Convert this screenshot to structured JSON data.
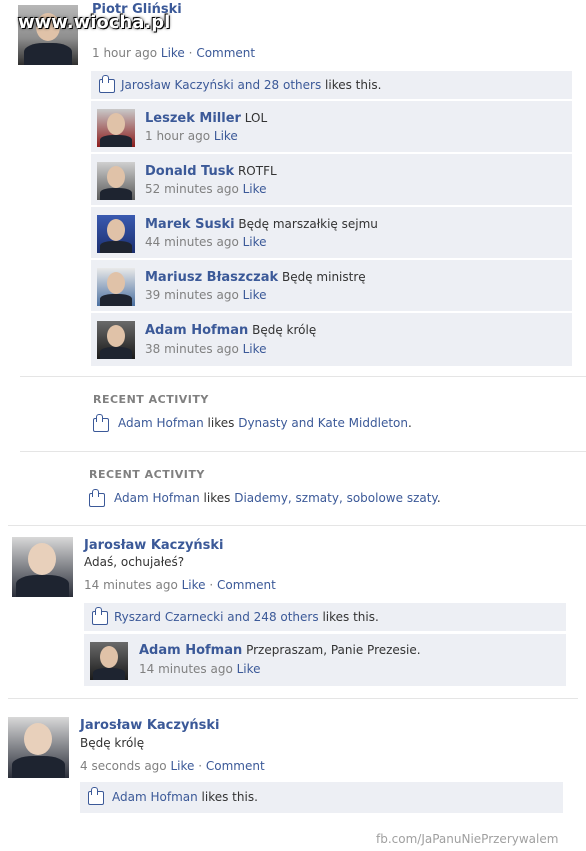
{
  "watermark": "www.wiocha.pl",
  "post1": {
    "author": "Piotr Gliński",
    "meta": {
      "time": "1 hour ago",
      "like": "Like",
      "dot": "·",
      "comment": "Comment"
    },
    "likes": {
      "text": "Jarosław Kaczyński and 28 others",
      "suffix": "likes this."
    },
    "comments": [
      {
        "author": "Leszek Miller",
        "text": "LOL",
        "time": "1 hour ago",
        "like": "Like"
      },
      {
        "author": "Donald Tusk",
        "text": "ROTFL",
        "time": "52 minutes ago",
        "like": "Like"
      },
      {
        "author": "Marek Suski",
        "text": "Będę marszałkię sejmu",
        "time": "44 minutes ago",
        "like": "Like"
      },
      {
        "author": "Mariusz Błaszczak",
        "text": "Będę ministrę",
        "time": "39 minutes ago",
        "like": "Like"
      },
      {
        "author": "Adam Hofman",
        "text": "Będę królę",
        "time": "38 minutes ago",
        "like": "Like"
      }
    ]
  },
  "recent1": {
    "title": "RECENT ACTIVITY",
    "actor": "Adam Hofman",
    "verb": "likes",
    "object": "Dynasty and Kate Middleton",
    "end": "."
  },
  "recent2": {
    "title": "RECENT ACTIVITY",
    "actor": "Adam Hofman",
    "verb": "likes",
    "object": "Diademy, szmaty, sobolowe szaty",
    "end": "."
  },
  "post2": {
    "author": "Jarosław Kaczyński",
    "text": "Adaś, ochujałeś?",
    "meta": {
      "time": "14 minutes ago",
      "like": "Like",
      "dot": "·",
      "comment": "Comment"
    },
    "likes": {
      "text": "Ryszard Czarnecki and 248 others",
      "suffix": "likes this."
    },
    "comment": {
      "author": "Adam Hofman",
      "text": "Przepraszam, Panie Prezesie.",
      "time": "14 minutes ago",
      "like": "Like"
    }
  },
  "post3": {
    "author": "Jarosław Kaczyński",
    "text": "Będę królę",
    "meta": {
      "time": "4 seconds ago",
      "like": "Like",
      "dot": "·",
      "comment": "Comment"
    },
    "likes": {
      "text": "Adam Hofman",
      "suffix": "likes this."
    }
  },
  "footer": "fb.com/JaPanuNiePrzerywalem",
  "colors": {
    "link": "#3b5998",
    "box": "#edeff4",
    "muted": "#808080"
  },
  "icons": [
    "thumbs-up-icon",
    "like-page-icon",
    "avatar-photo"
  ]
}
